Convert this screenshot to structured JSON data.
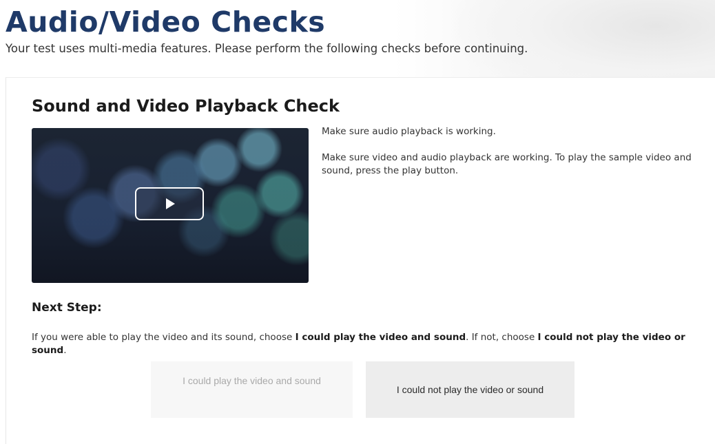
{
  "header": {
    "title": "Audio/Video Checks",
    "subtitle": "Your test uses multi-media features. Please perform the following checks before continuing."
  },
  "check": {
    "title": "Sound and Video Playback Check",
    "play_icon": "play-icon",
    "info_1": "Make sure audio playback is working.",
    "info_2": "Make sure video and audio playback are working. To play the sample video and sound, press the play button."
  },
  "next_step": {
    "heading": "Next Step:",
    "text_1": "If you were able to play the video and its sound, choose ",
    "bold_1": "I could play the video and sound",
    "text_2": ". If not, choose ",
    "bold_2": "I could not play the video or sound",
    "text_3": "."
  },
  "choices": {
    "yes_label": "I could play the video and sound",
    "no_label": "I could not play the video or sound"
  },
  "colors": {
    "title": "#1f3a68",
    "choice_disabled_text": "#a9a9a9",
    "choice_enabled_bg": "#ededed"
  }
}
